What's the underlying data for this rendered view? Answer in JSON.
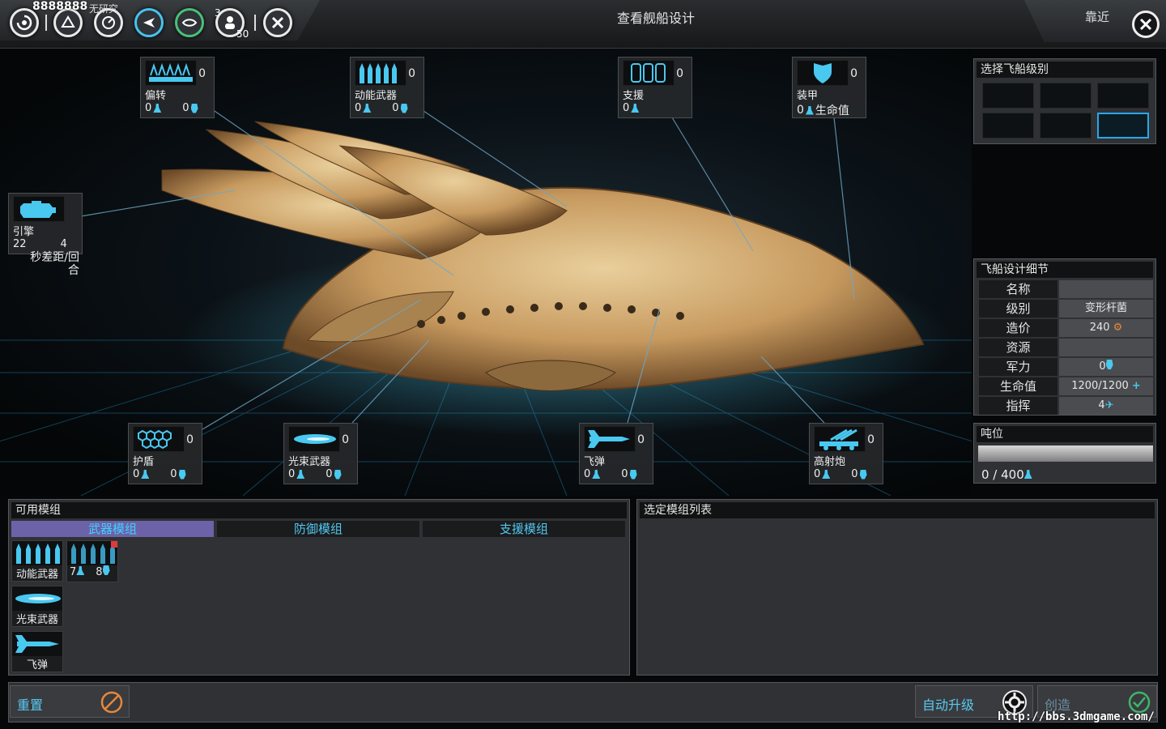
{
  "window": {
    "title": "查看舰船设计",
    "zoom_label": "靠近"
  },
  "topbar": {
    "research_value": "8888888",
    "research_label": "无研究",
    "badge_a": "3",
    "badge_b": "50",
    "icons": [
      "galaxy-icon",
      "empire-icon",
      "research-icon",
      "ship-design-icon",
      "diplomacy-icon",
      "population-icon",
      "settings-icon"
    ]
  },
  "slots": {
    "deflector": {
      "name": "偏转",
      "count": "0",
      "a": "0",
      "b": "0"
    },
    "kinetic": {
      "name": "动能武器",
      "count": "0",
      "a": "0",
      "b": "0"
    },
    "support": {
      "name": "支援",
      "count": "0",
      "a": "0"
    },
    "armor": {
      "name": "装甲",
      "count": "0",
      "a": "0",
      "hp_label": "生命值"
    },
    "engine": {
      "name": "引擎",
      "a": "22",
      "b": "4",
      "note": "秒差距/回合"
    },
    "shield": {
      "name": "护盾",
      "count": "0",
      "a": "0",
      "b": "0"
    },
    "beam": {
      "name": "光束武器",
      "count": "0",
      "a": "0",
      "b": "0"
    },
    "missile": {
      "name": "飞弹",
      "count": "0",
      "a": "0",
      "b": "0"
    },
    "flak": {
      "name": "高射炮",
      "count": "0",
      "a": "0",
      "b": "0"
    }
  },
  "ship_class": {
    "title": "选择飞船级别",
    "selected_index": 5
  },
  "details": {
    "title": "飞船设计细节",
    "rows": [
      {
        "k": "名称",
        "v": ""
      },
      {
        "k": "级别",
        "v": "变形杆菌"
      },
      {
        "k": "造价",
        "v": "240"
      },
      {
        "k": "资源",
        "v": ""
      },
      {
        "k": "军力",
        "v": "0"
      },
      {
        "k": "生命值",
        "v": "1200/1200"
      },
      {
        "k": "指挥",
        "v": "4"
      }
    ]
  },
  "tonnage": {
    "title": "吨位",
    "text": "0 / 400",
    "fill": 0
  },
  "available": {
    "title": "可用模组",
    "tabs": [
      "武器模组",
      "防御模组",
      "支援模组"
    ],
    "active_tab": 0,
    "modules": [
      {
        "name": "动能武器"
      },
      {
        "name": "",
        "a": "7",
        "b": "8"
      },
      {
        "name": "光束武器"
      },
      {
        "name": "飞弹"
      }
    ]
  },
  "selected_list": {
    "title": "选定模组列表"
  },
  "buttons": {
    "reset": "重置",
    "auto": "自动升级",
    "create": "创造"
  },
  "watermark": "http://bbs.3dmgame.com/",
  "colors": {
    "accent": "#49c8f0",
    "tab_active": "#6c62a8",
    "hull": "#c9a36b"
  }
}
